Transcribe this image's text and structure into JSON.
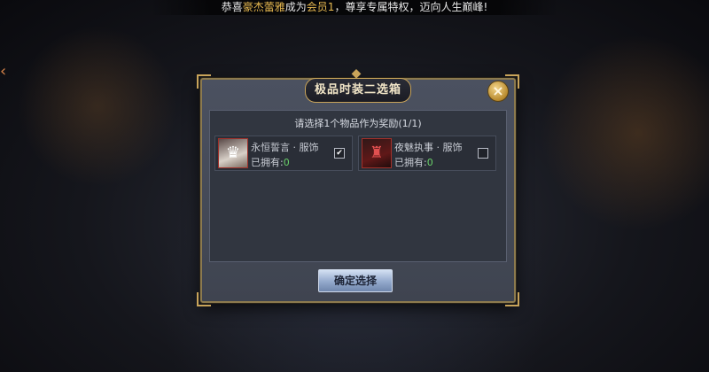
{
  "announcement": {
    "prefix": "恭喜",
    "player": "豪杰蕾雅",
    "middle": "成为",
    "rank": "会员1",
    "suffix": "，尊享专属特权，迈向人生巅峰!"
  },
  "dialog": {
    "title": "极品时装二选箱",
    "close_label": "×",
    "prompt": "请选择1个物品作为奖励(1/1)",
    "items": [
      {
        "name": "永恒誓言 · 服饰",
        "owned_label": "已拥有:",
        "owned_count": "0",
        "checked": true,
        "icon": "costume-white-icon",
        "check_mark": "✔"
      },
      {
        "name": "夜魅执事 · 服饰",
        "owned_label": "已拥有:",
        "owned_count": "0",
        "checked": false,
        "icon": "costume-dark-icon",
        "check_mark": ""
      }
    ],
    "confirm_label": "确定选择"
  },
  "colors": {
    "gold": "#c9a45a",
    "owned_count": "#6ad16a",
    "highlight": "#e6b850"
  }
}
